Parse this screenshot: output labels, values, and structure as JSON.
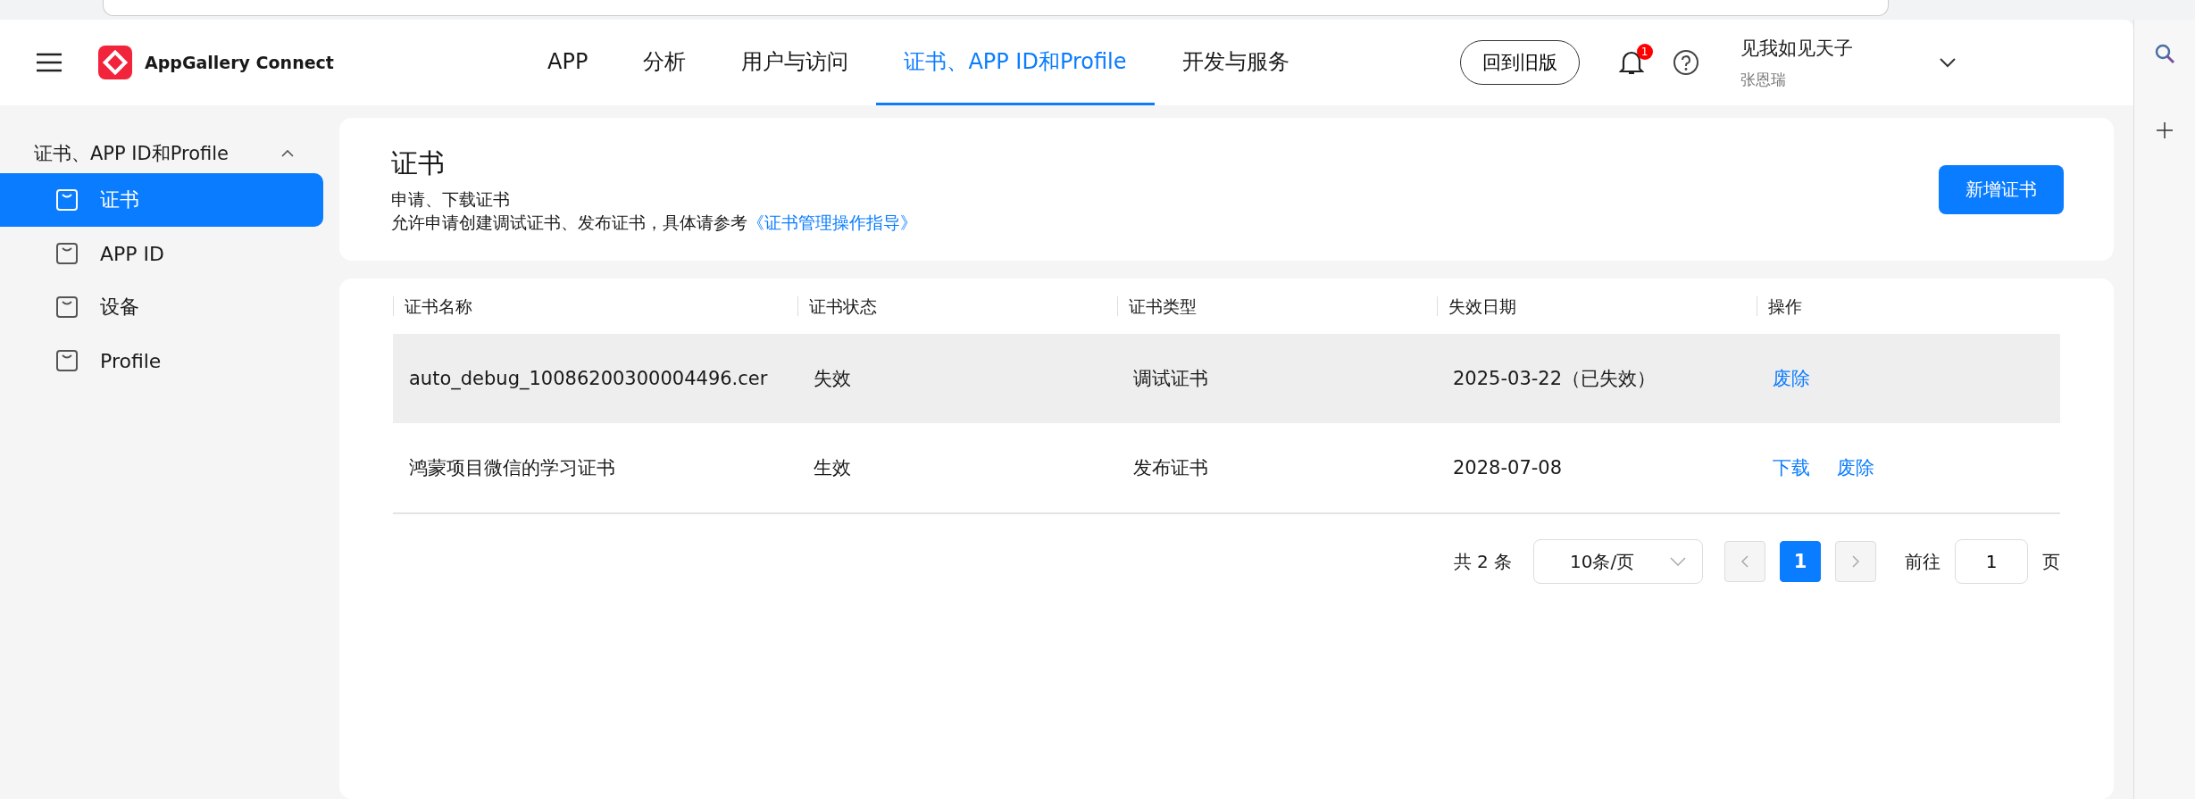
{
  "app_name": "AppGallery Connect",
  "nav_tabs": [
    {
      "label": "APP",
      "selected": false
    },
    {
      "label": "分析",
      "selected": false
    },
    {
      "label": "用户与访问",
      "selected": false
    },
    {
      "label": "证书、APP ID和Profile",
      "selected": true
    },
    {
      "label": "开发与服务",
      "selected": false
    }
  ],
  "old_version_button": "回到旧版",
  "notifications": {
    "badge": "1"
  },
  "user": {
    "name": "见我如见天子",
    "account": "张恩瑞"
  },
  "sidebar": {
    "group": {
      "label": "证书、APP ID和Profile",
      "expanded": true
    },
    "items": [
      {
        "label": "证书",
        "selected": true
      },
      {
        "label": "APP ID",
        "selected": false
      },
      {
        "label": "设备",
        "selected": false
      },
      {
        "label": "Profile",
        "selected": false
      }
    ]
  },
  "page": {
    "title": "证书",
    "subtitle": "申请、下载证书",
    "description": "允许申请创建调试证书、发布证书，具体请参考",
    "link": "《证书管理操作指导》",
    "add_button": "新增证书"
  },
  "table": {
    "columns": [
      "证书名称",
      "证书状态",
      "证书类型",
      "失效日期",
      "操作"
    ],
    "rows": [
      {
        "cells": [
          "auto_debug_10086200300004496.cer",
          "失效",
          "调试证书",
          "2025-03-22（已失效）"
        ],
        "actions": [
          "废除"
        ],
        "highlighted": true
      },
      {
        "cells": [
          "鸿蒙项目微信的学习证书",
          "生效",
          "发布证书",
          "2028-07-08"
        ],
        "actions": [
          "下载",
          "废除"
        ],
        "highlighted": false
      }
    ]
  },
  "pagination": {
    "total": "共 2 条",
    "page_size": "10条/页",
    "pages": [
      {
        "label": "1",
        "selected": true
      }
    ],
    "goto_label": "前往",
    "goto_value": "1",
    "page_suffix": "页"
  }
}
